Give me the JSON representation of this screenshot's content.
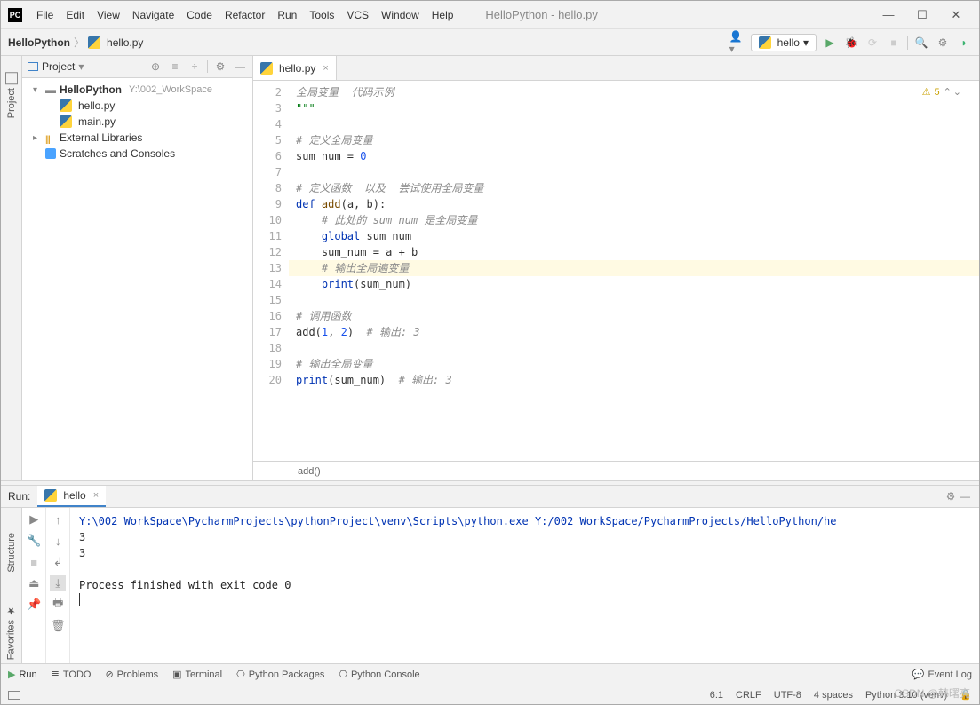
{
  "window": {
    "title": "HelloPython - hello.py"
  },
  "menus": [
    "File",
    "Edit",
    "View",
    "Navigate",
    "Code",
    "Refactor",
    "Run",
    "Tools",
    "VCS",
    "Window",
    "Help"
  ],
  "breadcrumb": {
    "project": "HelloPython",
    "file": "hello.py"
  },
  "run_config": {
    "name": "hello"
  },
  "project_panel": {
    "title": "Project",
    "root": {
      "name": "HelloPython",
      "path": "Y:\\002_WorkSpace"
    },
    "files": [
      "hello.py",
      "main.py"
    ],
    "external": "External Libraries",
    "scratches": "Scratches and Consoles"
  },
  "editor": {
    "tab": "hello.py",
    "warnings": "5",
    "breadcrumb_fn": "add()",
    "lines": [
      {
        "n": 2,
        "html": "<span class='com'>全局变量  代码示例</span>"
      },
      {
        "n": 3,
        "html": "<span class='str'>\"\"\"</span>"
      },
      {
        "n": 4,
        "html": ""
      },
      {
        "n": 5,
        "html": "<span class='com'># 定义全局变量</span>"
      },
      {
        "n": 6,
        "html": "sum_num = <span class='num'>0</span>"
      },
      {
        "n": 7,
        "html": ""
      },
      {
        "n": 8,
        "html": "<span class='com'># 定义函数  以及  尝试使用全局变量</span>"
      },
      {
        "n": 9,
        "html": "<span class='kw'>def</span> <span class='fn'>add</span>(a, b):"
      },
      {
        "n": 10,
        "html": "    <span class='com'># 此处的 sum_num 是全局变量</span>"
      },
      {
        "n": 11,
        "html": "    <span class='kw'>global</span> sum_num"
      },
      {
        "n": 12,
        "html": "    sum_num = a + b"
      },
      {
        "n": 13,
        "html": "    <span class='com'># 输出全局遍变量</span>",
        "hl": true
      },
      {
        "n": 14,
        "html": "    <span class='kw'>print</span>(sum_num)"
      },
      {
        "n": 15,
        "html": ""
      },
      {
        "n": 16,
        "html": "<span class='com'># 调用函数</span>"
      },
      {
        "n": 17,
        "html": "add(<span class='num'>1</span>, <span class='num'>2</span>)  <span class='com'># 输出: 3</span>"
      },
      {
        "n": 18,
        "html": ""
      },
      {
        "n": 19,
        "html": "<span class='com'># 输出全局变量</span>"
      },
      {
        "n": 20,
        "html": "<span class='kw'>print</span>(sum_num)  <span class='com'># 输出: 3</span>"
      }
    ]
  },
  "run": {
    "label": "Run:",
    "tab": "hello",
    "output_path": "Y:\\002_WorkSpace\\PycharmProjects\\pythonProject\\venv\\Scripts\\python.exe Y:/002_WorkSpace/PycharmProjects/HelloPython/he",
    "out_lines": [
      "3",
      "3"
    ],
    "exit_msg": "Process finished with exit code 0"
  },
  "bottom_tabs": {
    "run": "Run",
    "todo": "TODO",
    "problems": "Problems",
    "terminal": "Terminal",
    "packages": "Python Packages",
    "console": "Python Console",
    "eventlog": "Event Log"
  },
  "status": {
    "pos": "6:1",
    "eol": "CRLF",
    "enc": "UTF-8",
    "indent": "4 spaces",
    "interp": "Python 3.10 (venv)"
  },
  "sidebar": {
    "project": "Project",
    "structure": "Structure",
    "favorites": "Favorites"
  },
  "watermark": "CSDN @韩曙亮"
}
